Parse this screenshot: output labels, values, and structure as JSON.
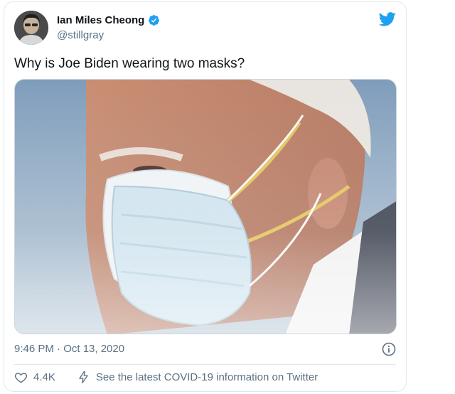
{
  "tweet": {
    "author_name": "Ian Miles Cheong",
    "author_handle": "@stillgray",
    "text": "Why is Joe Biden wearing two masks?",
    "timestamp": "9:46 PM · Oct 13, 2020",
    "likes": "4.4K",
    "covid_link": "See the latest COVID-19 information on Twitter",
    "media_alt": "photo of a man wearing a surgical mask over an N95 mask"
  },
  "icons": {
    "verified": "verified-badge-icon",
    "brand": "twitter-bird-icon",
    "info": "info-icon",
    "like": "heart-icon",
    "covid": "lightning-icon"
  },
  "colors": {
    "brand": "#1da1f2",
    "text": "#0f1419",
    "secondary": "#5b7083",
    "border": "#e1e8ed"
  }
}
